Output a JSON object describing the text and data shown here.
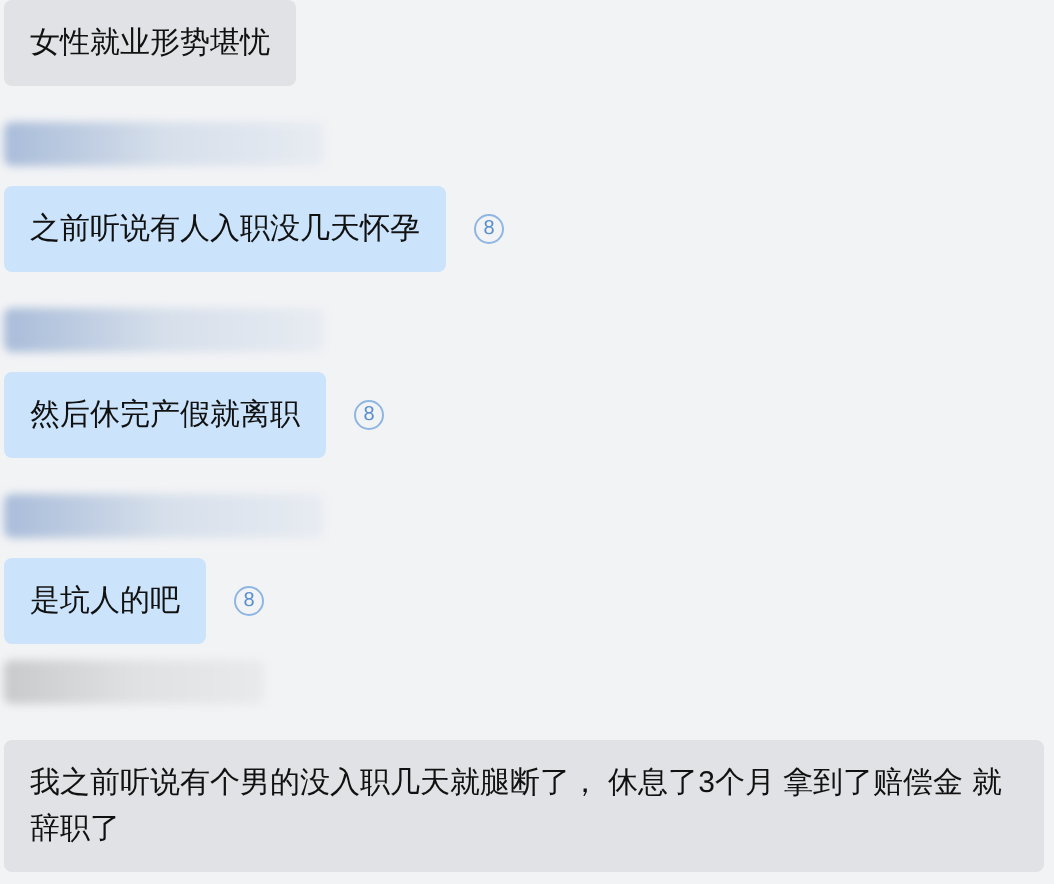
{
  "messages": [
    {
      "text": "女性就业形势堪忧",
      "highlighted": false,
      "name_blurred": false
    },
    {
      "text": "之前听说有人入职没几天怀孕",
      "highlighted": true,
      "name_blurred": true,
      "read_count": "8"
    },
    {
      "text": "然后休完产假就离职",
      "highlighted": true,
      "name_blurred": true,
      "read_count": "8"
    },
    {
      "text": "是坑人的吧",
      "highlighted": true,
      "name_blurred": true,
      "read_count": "8"
    },
    {
      "text": "我之前听说有个男的没入职几天就腿断了， 休息了3个月 拿到了赔偿金 就辞职了",
      "highlighted": false,
      "name_blurred": true
    }
  ]
}
